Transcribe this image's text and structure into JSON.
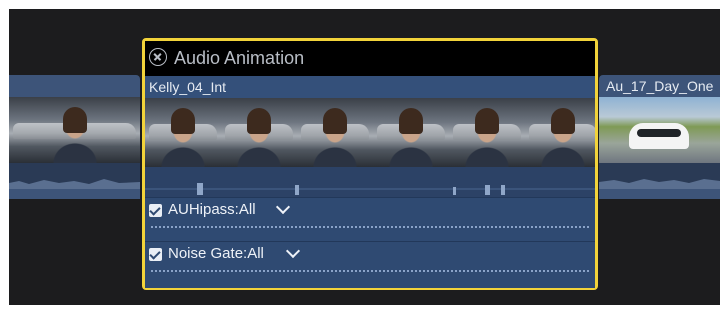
{
  "timeline": {
    "clip_left": {
      "name": ""
    },
    "clip_center": {
      "animation_title": "Audio Animation",
      "name": "Kelly_04_Int",
      "effects": [
        {
          "label": "AUHipass:All",
          "checked": true
        },
        {
          "label": "Noise Gate:All",
          "checked": true
        }
      ]
    },
    "clip_right": {
      "name": "Au_17_Day_One"
    }
  },
  "colors": {
    "selection": "#f2d33a",
    "clip": "#3d5479",
    "background": "#1c1c1e"
  }
}
